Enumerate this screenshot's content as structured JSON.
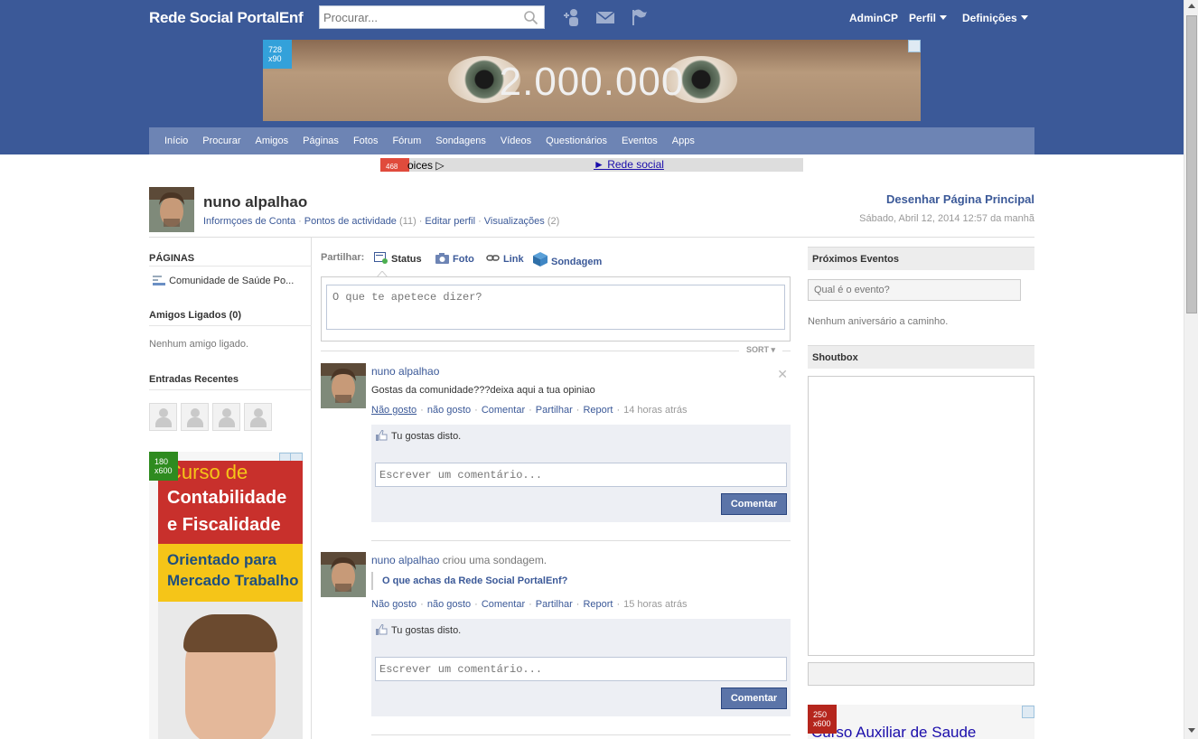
{
  "header": {
    "site_title": "Rede Social PortalEnf",
    "search_placeholder": "Procurar...",
    "links": {
      "admincp": "AdminCP",
      "perfil": "Perfil",
      "definicoes": "Definições"
    }
  },
  "banner": {
    "text": "2.000.000",
    "size_label_w": "728",
    "size_label_h": "x90"
  },
  "nav": [
    "Início",
    "Procurar",
    "Amigos",
    "Páginas",
    "Fotos",
    "Fórum",
    "Sondagens",
    "Vídeos",
    "Questionários",
    "Eventos",
    "Apps"
  ],
  "adstrip": {
    "badge": "468",
    "left_text": "oices ▷",
    "link_text": "► Rede social"
  },
  "profile": {
    "name": "nuno alpalhao",
    "links": {
      "account_info": "Informçoes de Conta",
      "activity_points": "Pontos de actividade",
      "activity_count": "(11)",
      "edit_profile": "Editar perfil",
      "views": "Visualizações",
      "views_count": "(2)"
    },
    "design_link": "Desenhar Página Principal",
    "date": "Sábado, Abril 12, 2014 12:57 da manhã"
  },
  "left": {
    "pages_title": "PÁGINAS",
    "page_item": "Comunidade de Saúde Po...",
    "friends_title": "Amigos Ligados (0)",
    "no_friends": "Nenhum amigo ligado.",
    "recent_title": "Entradas Recentes",
    "ad": {
      "size_w": "180",
      "size_h": "x600",
      "line1": "Curso de",
      "line2": "Contabilidade",
      "line3": "e Fiscalidade",
      "line4": "Orientado para",
      "line5": "Mercado Trabalho"
    }
  },
  "center": {
    "share_label": "Partilhar:",
    "share_options": {
      "status": "Status",
      "photo": "Foto",
      "link": "Link",
      "poll": "Sondagem"
    },
    "composer_placeholder": "O que te apetece dizer?",
    "sort_label": "SORT ▾",
    "posts": [
      {
        "author": "nuno alpalhao",
        "action": "",
        "text": "Gostas da comunidade???deixa aqui a tua opiniao",
        "meta": {
          "unlike": "Não gosto",
          "dislike": "não gosto",
          "comment": "Comentar",
          "share": "Partilhar",
          "report": "Report",
          "time": "14 horas atrás"
        },
        "likes_text": "Tu gostas disto.",
        "comment_placeholder": "Escrever um comentário...",
        "comment_button": "Comentar"
      },
      {
        "author": "nuno alpalhao",
        "action": "criou uma sondagem.",
        "poll_question": "O que achas da Rede Social PortalEnf?",
        "meta": {
          "unlike": "Não gosto",
          "dislike": "não gosto",
          "comment": "Comentar",
          "share": "Partilhar",
          "report": "Report",
          "time": "15 horas atrás"
        },
        "likes_text": "Tu gostas disto.",
        "comment_placeholder": "Escrever um comentário...",
        "comment_button": "Comentar"
      }
    ]
  },
  "right": {
    "events_title": "Próximos Eventos",
    "event_placeholder": "Qual é o evento?",
    "no_birthdays": "Nenhum aniversário a caminho.",
    "shoutbox_title": "Shoutbox",
    "ad": {
      "size_w": "250",
      "size_h": "x600",
      "text": "Curso Auxiliar de Saude"
    }
  },
  "colors": {
    "header_blue": "#3b5998",
    "nav_blue": "#6d84b4",
    "link_blue": "#3b5998"
  }
}
